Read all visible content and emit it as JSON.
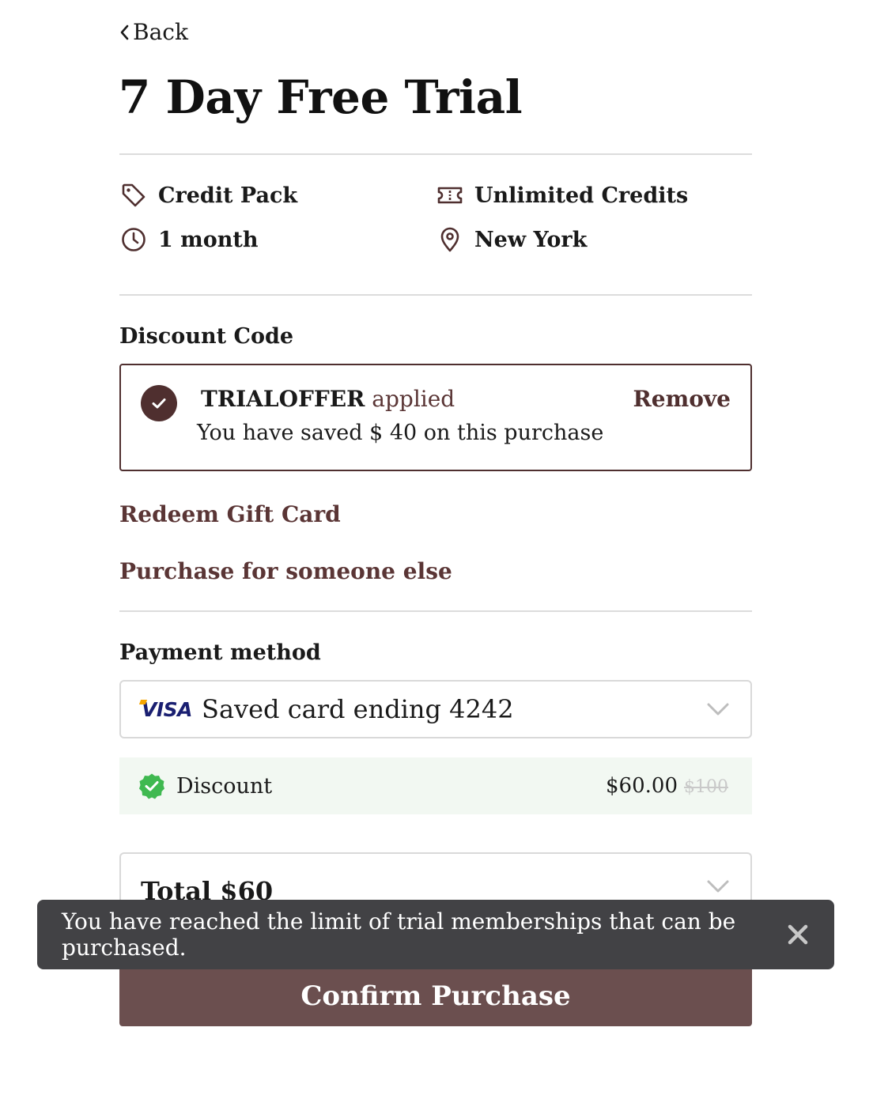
{
  "nav": {
    "back_label": "Back"
  },
  "product": {
    "title": "7 Day Free Trial",
    "type_label": "Credit Pack",
    "credits_label": "Unlimited Credits",
    "duration_label": "1 month",
    "location_label": "New York"
  },
  "discount": {
    "section_label": "Discount Code",
    "code": "TRIALOFFER",
    "applied_label": "applied",
    "saved_message": "You have saved $ 40 on this purchase",
    "remove_label": "Remove"
  },
  "links": {
    "gift_card": "Redeem Gift Card",
    "someone_else": "Purchase for someone else"
  },
  "payment": {
    "section_label": "Payment method",
    "card_brand": "VISA",
    "selected_value": "Saved card ending 4242"
  },
  "summary": {
    "discount_label": "Discount",
    "discounted_price": "$60.00",
    "original_price": "$100",
    "total_label": "Total $60"
  },
  "actions": {
    "confirm_label": "Confirm Purchase"
  },
  "toast": {
    "message": "You have reached the limit of trial memberships that can be purchased."
  },
  "colors": {
    "brand": "#4f2f2f",
    "confirm_bg": "#6b4f4f",
    "success": "#3fb950",
    "toast_bg": "#424245"
  }
}
